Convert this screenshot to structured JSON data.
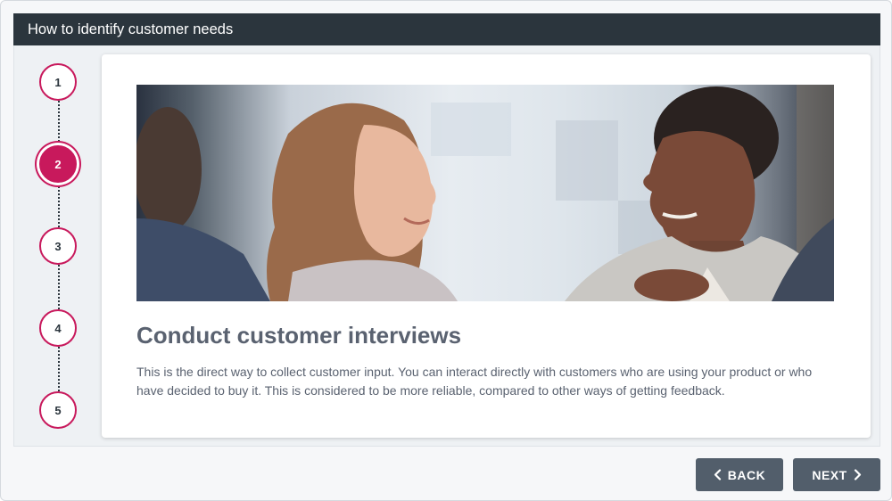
{
  "header": {
    "title": "How to identify customer needs"
  },
  "stepper": {
    "steps": [
      {
        "label": "1",
        "active": false
      },
      {
        "label": "2",
        "active": true
      },
      {
        "label": "3",
        "active": false
      },
      {
        "label": "4",
        "active": false
      },
      {
        "label": "5",
        "active": false
      }
    ]
  },
  "slide": {
    "image_subject": "two-women-conversation-photo",
    "heading": "Conduct customer interviews",
    "body": "This is the direct way to collect customer input. You can interact directly with customers who are using your product or who have decided to buy it. This is considered to be more reliable, compared to other ways of getting feedback."
  },
  "navigation": {
    "back_label": "BACK",
    "next_label": "NEXT",
    "back_icon": "chevron-left-icon",
    "next_icon": "chevron-right-icon"
  },
  "colors": {
    "accent": "#c8195c",
    "header_bg": "#2b353d",
    "button_bg": "#525e6b",
    "text": "#5a6270"
  }
}
